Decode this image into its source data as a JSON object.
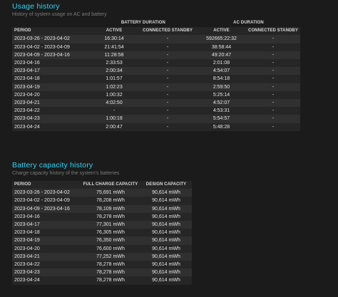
{
  "usage": {
    "title": "Usage history",
    "subtitle": "History of system usage on AC and battery",
    "group_battery": "BATTERY DURATION",
    "group_ac": "AC DURATION",
    "columns": [
      "PERIOD",
      "ACTIVE",
      "CONNECTED STANDBY",
      "ACTIVE",
      "CONNECTED STANDBY"
    ],
    "rows": [
      [
        "2023-03-26 - 2023-04-02",
        "16:30:14",
        "-",
        "592665:22:32",
        "-"
      ],
      [
        "2023-04-02 - 2023-04-09",
        "21:41:54",
        "-",
        "38:58:44",
        "-"
      ],
      [
        "2023-04-09 - 2023-04-16",
        "11:28:58",
        "-",
        "49:20:47",
        "-"
      ],
      [
        "2023-04-16",
        "2:33:53",
        "-",
        "2:01:08",
        "-"
      ],
      [
        "2023-04-17",
        "2:00:34",
        "-",
        "4:54:07",
        "-"
      ],
      [
        "2023-04-18",
        "1:01:57",
        "-",
        "8:54:18",
        "-"
      ],
      [
        "2023-04-19",
        "1:02:23",
        "-",
        "2:59:50",
        "-"
      ],
      [
        "2023-04-20",
        "1:00:32",
        "-",
        "5:25:14",
        "-"
      ],
      [
        "2023-04-21",
        "4:02:50",
        "-",
        "4:52:07",
        "-"
      ],
      [
        "2023-04-22",
        "-",
        "-",
        "4:53:31",
        "-"
      ],
      [
        "2023-04-23",
        "1:00:18",
        "-",
        "5:54:57",
        "-"
      ],
      [
        "2023-04-24",
        "2:00:47",
        "-",
        "5:48:28",
        "-"
      ]
    ]
  },
  "capacity": {
    "title": "Battery capacity history",
    "subtitle": "Charge capacity history of the system's batteries",
    "columns": [
      "PERIOD",
      "FULL CHARGE CAPACITY",
      "DESIGN CAPACITY"
    ],
    "rows": [
      [
        "2023-03-26 - 2023-04-02",
        "75,691 mWh",
        "90,614 mWh"
      ],
      [
        "2023-04-02 - 2023-04-09",
        "78,208 mWh",
        "90,614 mWh"
      ],
      [
        "2023-04-09 - 2023-04-16",
        "78,109 mWh",
        "90,614 mWh"
      ],
      [
        "2023-04-16",
        "78,278 mWh",
        "90,614 mWh"
      ],
      [
        "2023-04-17",
        "77,301 mWh",
        "90,614 mWh"
      ],
      [
        "2023-04-18",
        "76,305 mWh",
        "90,614 mWh"
      ],
      [
        "2023-04-19",
        "76,350 mWh",
        "90,614 mWh"
      ],
      [
        "2023-04-20",
        "76,600 mWh",
        "90,614 mWh"
      ],
      [
        "2023-04-21",
        "77,252 mWh",
        "90,614 mWh"
      ],
      [
        "2023-04-22",
        "78,278 mWh",
        "90,614 mWh"
      ],
      [
        "2023-04-23",
        "78,278 mWh",
        "90,614 mWh"
      ],
      [
        "2023-04-24",
        "78,278 mWh",
        "90,614 mWh"
      ]
    ]
  },
  "colors": {
    "background": "#1b1b1b",
    "heading": "#2fd3f5",
    "subtitle": "#7b7b7b",
    "row_odd": "#303030",
    "row_even": "#262626"
  }
}
